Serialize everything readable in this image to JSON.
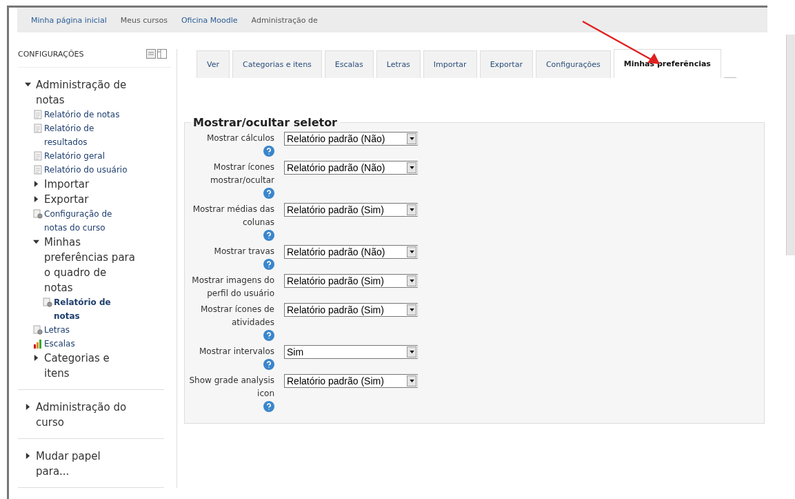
{
  "breadcrumb": [
    {
      "label": "Minha página inicial",
      "link": true
    },
    {
      "label": "Meus cursos",
      "link": false
    },
    {
      "label": "Oficina Moodle",
      "link": true
    },
    {
      "label": "Administração de",
      "link": false
    }
  ],
  "sidebar": {
    "title": "CONFIGURAÇÕES",
    "groups": [
      {
        "items": [
          {
            "label": "Administração de notas",
            "kind": "branch",
            "expanded": true,
            "children": [
              {
                "label": "Relatório de notas",
                "kind": "report",
                "selected": false
              },
              {
                "label": "Relatório de resultados",
                "kind": "report",
                "selected": false
              },
              {
                "label": "Relatório geral",
                "kind": "report",
                "selected": false
              },
              {
                "label": "Relatório do usuário",
                "kind": "report",
                "selected": false
              },
              {
                "label": "Importar",
                "kind": "branch",
                "expanded": false
              },
              {
                "label": "Exportar",
                "kind": "branch",
                "expanded": false
              },
              {
                "label": "Configuração de notas do curso",
                "kind": "settings",
                "selected": false
              },
              {
                "label": "Minhas preferências para o quadro de notas",
                "kind": "branch",
                "expanded": true,
                "children": [
                  {
                    "label": "Relatório de notas",
                    "kind": "settings",
                    "selected": true
                  }
                ]
              },
              {
                "label": "Letras",
                "kind": "settings",
                "selected": false
              },
              {
                "label": "Escalas",
                "kind": "scales",
                "selected": false
              },
              {
                "label": "Categorias e itens",
                "kind": "branch",
                "expanded": false
              }
            ]
          }
        ]
      },
      {
        "items": [
          {
            "label": "Administração do curso",
            "kind": "branch",
            "expanded": false
          }
        ]
      },
      {
        "items": [
          {
            "label": "Mudar papel para...",
            "kind": "branch",
            "expanded": false
          }
        ]
      }
    ]
  },
  "tabs": [
    {
      "label": "Ver",
      "selected": false
    },
    {
      "label": "Categorias e itens",
      "selected": false
    },
    {
      "label": "Escalas",
      "selected": false
    },
    {
      "label": "Letras",
      "selected": false
    },
    {
      "label": "Importar",
      "selected": false
    },
    {
      "label": "Exportar",
      "selected": false
    },
    {
      "label": "Configurações",
      "selected": false
    },
    {
      "label": "Minhas preferências",
      "selected": true
    }
  ],
  "form": {
    "legend": "Mostrar/ocultar seletor",
    "rows": [
      {
        "label": "Mostrar cálculos",
        "value": "Relatório padrão (Não)",
        "help": true
      },
      {
        "label": "Mostrar ícones mostrar/ocultar",
        "value": "Relatório padrão (Não)",
        "help": true
      },
      {
        "label": "Mostrar médias das colunas",
        "value": "Relatório padrão (Sim)",
        "help": true
      },
      {
        "label": "Mostrar travas",
        "value": "Relatório padrão (Não)",
        "help": true
      },
      {
        "label": "Mostrar imagens do perfil do usuário",
        "value": "Relatório padrão (Sim)",
        "help": false
      },
      {
        "label": "Mostrar ícones de atividades",
        "value": "Relatório padrão (Sim)",
        "help": true
      },
      {
        "label": "Mostrar intervalos",
        "value": "Sim",
        "help": true
      },
      {
        "label": "Show grade analysis icon",
        "value": "Relatório padrão (Sim)",
        "help": true
      }
    ]
  }
}
